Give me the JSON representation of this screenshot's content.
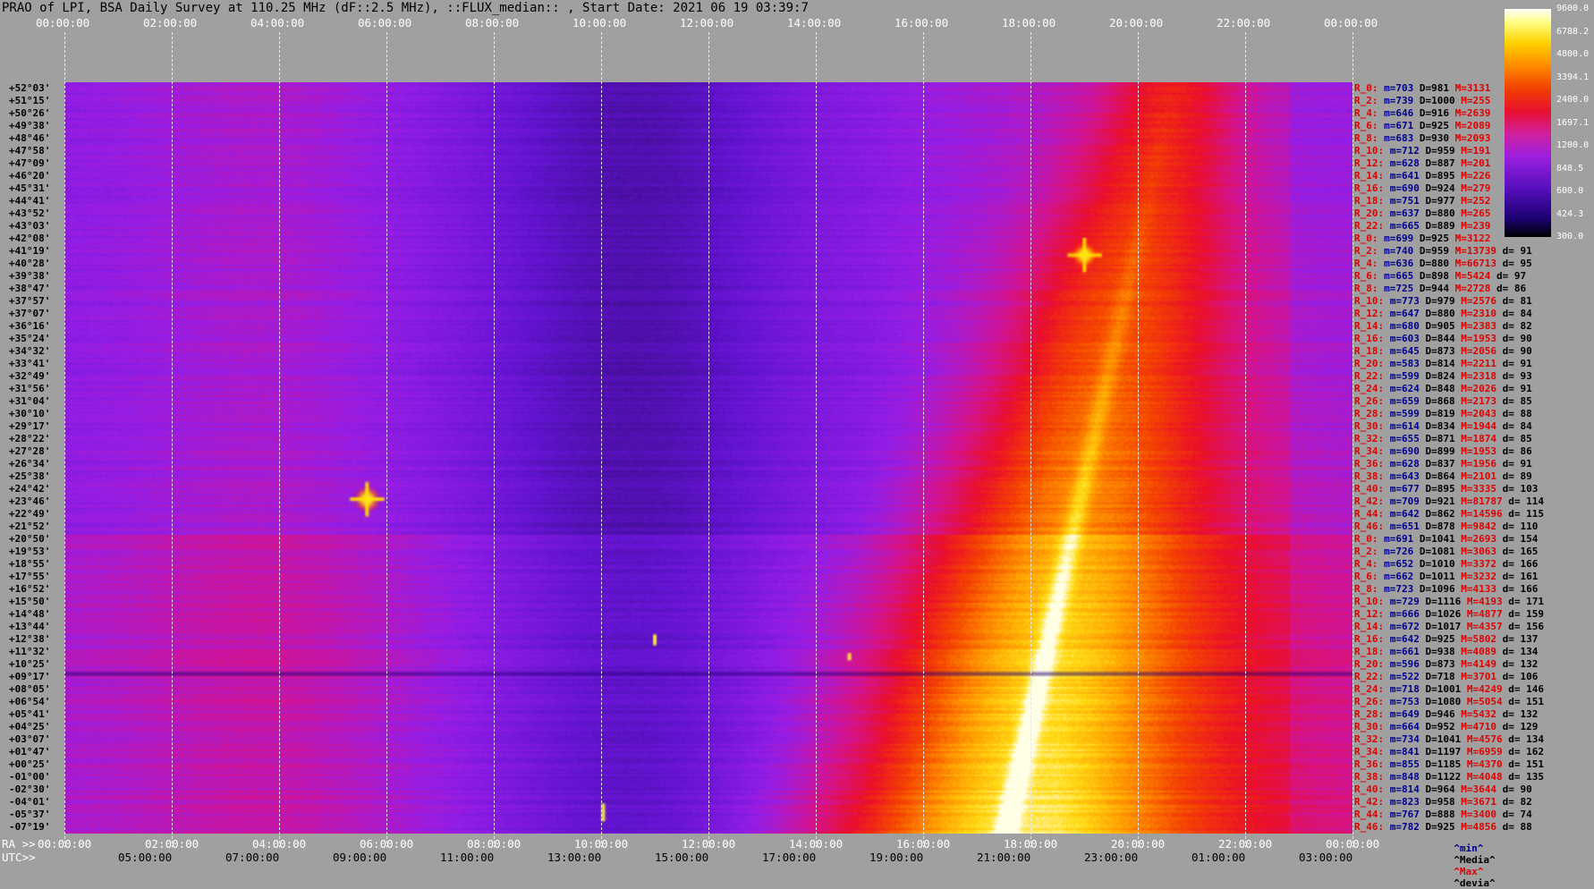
{
  "title": "PRAO of LPI, BSA Daily Survey at 110.25 MHz (dF::2.5 MHz), ::FLUX_median:: , Start Date: 2021 06 19 03:39:7",
  "top_ticks": [
    "00:00:00",
    "02:00:00",
    "04:00:00",
    "06:00:00",
    "08:00:00",
    "10:00:00",
    "12:00:00",
    "14:00:00",
    "16:00:00",
    "18:00:00",
    "20:00:00",
    "22:00:00",
    "00:00:00"
  ],
  "bottom_ra_label": "RA >>",
  "bottom_ra_ticks": [
    "00:00:00",
    "02:00:00",
    "04:00:00",
    "06:00:00",
    "08:00:00",
    "10:00:00",
    "12:00:00",
    "14:00:00",
    "16:00:00",
    "18:00:00",
    "20:00:00",
    "22:00:00",
    "00:00:00"
  ],
  "bottom_utc_label": "UTC>>",
  "bottom_utc_ticks": [
    "05:00:00",
    "07:00:00",
    "09:00:00",
    "11:00:00",
    "13:00:00",
    "15:00:00",
    "17:00:00",
    "19:00:00",
    "21:00:00",
    "23:00:00",
    "01:00:00",
    "03:00:00"
  ],
  "legend_ticks": [
    "9600.0",
    "6788.2",
    "4800.0",
    "3394.1",
    "2400.0",
    "1697.1",
    "1200.0",
    "848.5",
    "600.0",
    "424.3",
    "300.0"
  ],
  "legend_foot": {
    "min": "^min^",
    "media": "^Media^",
    "max": "^Max^",
    "devia": "^devia^"
  },
  "chart_data": {
    "type": "heatmap",
    "title": "PRAO of LPI, BSA Daily Survey at 110.25 MHz (dF::2.5 MHz), ::FLUX_median:: , Start Date: 2021 06 19 03:39:7",
    "xlabel": "RA >>",
    "x_range_hours": [
      0,
      24
    ],
    "colorbar_ticks": [
      9600.0,
      6788.2,
      4800.0,
      3394.1,
      2400.0,
      1697.1,
      1200.0,
      848.5,
      600.0,
      424.3,
      300.0
    ],
    "declinations": [
      "+52°03'",
      "+51°15'",
      "+50°26'",
      "+49°38'",
      "+48°46'",
      "+47°58'",
      "+47°09'",
      "+46°20'",
      "+45°31'",
      "+44°41'",
      "+43°52'",
      "+43°03'",
      "+42°08'",
      "+41°19'",
      "+40°28'",
      "+39°38'",
      "+38°47'",
      "+37°57'",
      "+37°07'",
      "+36°16'",
      "+35°24'",
      "+34°32'",
      "+33°41'",
      "+32°49'",
      "+31°56'",
      "+31°04'",
      "+30°10'",
      "+29°17'",
      "+28°22'",
      "+27°28'",
      "+26°34'",
      "+25°38'",
      "+24°42'",
      "+23°46'",
      "+22°49'",
      "+21°52'",
      "+20°50'",
      "+19°53'",
      "+18°55'",
      "+17°55'",
      "+16°52'",
      "+15°50'",
      "+14°48'",
      "+13°44'",
      "+12°38'",
      "+11°32'",
      "+10°25'",
      "+09°17'",
      "+08°05'",
      "+06°54'",
      "+05°41'",
      "+04°25'",
      "+03°07'",
      "+01°47'",
      "+00°25'",
      "-01°00'",
      "-02°30'",
      "-04°01'",
      "-05°37'",
      "-07°19'"
    ],
    "row_stats": [
      {
        "r": "R_0:",
        "m": "m=703",
        "d": "D=981",
        "x": "M=3131",
        "v": ""
      },
      {
        "r": "R_2:",
        "m": "m=739",
        "d": "D=1000",
        "x": "M=255",
        "v": ""
      },
      {
        "r": "R_4:",
        "m": "m=646",
        "d": "D=916",
        "x": "M=2639",
        "v": ""
      },
      {
        "r": "R_6:",
        "m": "m=671",
        "d": "D=925",
        "x": "M=2089",
        "v": ""
      },
      {
        "r": "R_8:",
        "m": "m=683",
        "d": "D=930",
        "x": "M=2093",
        "v": ""
      },
      {
        "r": "R_10:",
        "m": "m=712",
        "d": "D=959",
        "x": "M=191",
        "v": ""
      },
      {
        "r": "R_12:",
        "m": "m=628",
        "d": "D=887",
        "x": "M=201",
        "v": ""
      },
      {
        "r": "R_14:",
        "m": "m=641",
        "d": "D=895",
        "x": "M=226",
        "v": ""
      },
      {
        "r": "R_16:",
        "m": "m=690",
        "d": "D=924",
        "x": "M=279",
        "v": ""
      },
      {
        "r": "R_18:",
        "m": "m=751",
        "d": "D=977",
        "x": "M=252",
        "v": ""
      },
      {
        "r": "R_20:",
        "m": "m=637",
        "d": "D=880",
        "x": "M=265",
        "v": ""
      },
      {
        "r": "R_22:",
        "m": "m=665",
        "d": "D=889",
        "x": "M=239",
        "v": ""
      },
      {
        "r": "R_0:",
        "m": "m=699",
        "d": "D=925",
        "x": "M=3122",
        "v": ""
      },
      {
        "r": "R_2:",
        "m": "m=740",
        "d": "D=959",
        "x": "M=13739",
        "v": "d= 91"
      },
      {
        "r": "R_4:",
        "m": "m=636",
        "d": "D=880",
        "x": "M=66713",
        "v": "d= 95"
      },
      {
        "r": "R_6:",
        "m": "m=665",
        "d": "D=898",
        "x": "M=5424",
        "v": "d= 97"
      },
      {
        "r": "R_8:",
        "m": "m=725",
        "d": "D=944",
        "x": "M=2728",
        "v": "d= 86"
      },
      {
        "r": "R_10:",
        "m": "m=773",
        "d": "D=979",
        "x": "M=2576",
        "v": "d= 81"
      },
      {
        "r": "R_12:",
        "m": "m=647",
        "d": "D=880",
        "x": "M=2310",
        "v": "d= 84"
      },
      {
        "r": "R_14:",
        "m": "m=680",
        "d": "D=905",
        "x": "M=2383",
        "v": "d= 82"
      },
      {
        "r": "R_16:",
        "m": "m=603",
        "d": "D=844",
        "x": "M=1953",
        "v": "d= 90"
      },
      {
        "r": "R_18:",
        "m": "m=645",
        "d": "D=873",
        "x": "M=2056",
        "v": "d= 90"
      },
      {
        "r": "R_20:",
        "m": "m=583",
        "d": "D=814",
        "x": "M=2211",
        "v": "d= 91"
      },
      {
        "r": "R_22:",
        "m": "m=599",
        "d": "D=824",
        "x": "M=2318",
        "v": "d= 93"
      },
      {
        "r": "R_24:",
        "m": "m=624",
        "d": "D=848",
        "x": "M=2026",
        "v": "d= 91"
      },
      {
        "r": "R_26:",
        "m": "m=659",
        "d": "D=868",
        "x": "M=2173",
        "v": "d= 85"
      },
      {
        "r": "R_28:",
        "m": "m=599",
        "d": "D=819",
        "x": "M=2043",
        "v": "d= 88"
      },
      {
        "r": "R_30:",
        "m": "m=614",
        "d": "D=834",
        "x": "M=1944",
        "v": "d= 84"
      },
      {
        "r": "R_32:",
        "m": "m=655",
        "d": "D=871",
        "x": "M=1874",
        "v": "d= 85"
      },
      {
        "r": "R_34:",
        "m": "m=690",
        "d": "D=899",
        "x": "M=1953",
        "v": "d= 86"
      },
      {
        "r": "R_36:",
        "m": "m=628",
        "d": "D=837",
        "x": "M=1956",
        "v": "d= 91"
      },
      {
        "r": "R_38:",
        "m": "m=643",
        "d": "D=864",
        "x": "M=2101",
        "v": "d= 89"
      },
      {
        "r": "R_40:",
        "m": "m=677",
        "d": "D=895",
        "x": "M=3335",
        "v": "d= 103"
      },
      {
        "r": "R_42:",
        "m": "m=709",
        "d": "D=921",
        "x": "M=81787",
        "v": "d= 114"
      },
      {
        "r": "R_44:",
        "m": "m=642",
        "d": "D=862",
        "x": "M=14596",
        "v": "d= 115"
      },
      {
        "r": "R_46:",
        "m": "m=651",
        "d": "D=878",
        "x": "M=9842",
        "v": "d= 110"
      },
      {
        "r": "R_0:",
        "m": "m=691",
        "d": "D=1041",
        "x": "M=2693",
        "v": "d= 154"
      },
      {
        "r": "R_2:",
        "m": "m=726",
        "d": "D=1081",
        "x": "M=3063",
        "v": "d= 165"
      },
      {
        "r": "R_4:",
        "m": "m=652",
        "d": "D=1010",
        "x": "M=3372",
        "v": "d= 166"
      },
      {
        "r": "R_6:",
        "m": "m=662",
        "d": "D=1011",
        "x": "M=3232",
        "v": "d= 161"
      },
      {
        "r": "R_8:",
        "m": "m=723",
        "d": "D=1096",
        "x": "M=4133",
        "v": "d= 166"
      },
      {
        "r": "R_10:",
        "m": "m=729",
        "d": "D=1116",
        "x": "M=4193",
        "v": "d= 171"
      },
      {
        "r": "R_12:",
        "m": "m=666",
        "d": "D=1026",
        "x": "M=4877",
        "v": "d= 159"
      },
      {
        "r": "R_14:",
        "m": "m=672",
        "d": "D=1017",
        "x": "M=4357",
        "v": "d= 156"
      },
      {
        "r": "R_16:",
        "m": "m=642",
        "d": "D=925",
        "x": "M=5802",
        "v": "d= 137"
      },
      {
        "r": "R_18:",
        "m": "m=661",
        "d": "D=938",
        "x": "M=4089",
        "v": "d= 134"
      },
      {
        "r": "R_20:",
        "m": "m=596",
        "d": "D=873",
        "x": "M=4149",
        "v": "d= 132"
      },
      {
        "r": "R_22:",
        "m": "m=522",
        "d": "D=718",
        "x": "M=3701",
        "v": "d= 106"
      },
      {
        "r": "R_24:",
        "m": "m=718",
        "d": "D=1001",
        "x": "M=4249",
        "v": "d= 146"
      },
      {
        "r": "R_26:",
        "m": "m=753",
        "d": "D=1080",
        "x": "M=5054",
        "v": "d= 151"
      },
      {
        "r": "R_28:",
        "m": "m=649",
        "d": "D=946",
        "x": "M=5432",
        "v": "d= 132"
      },
      {
        "r": "R_30:",
        "m": "m=664",
        "d": "D=952",
        "x": "M=4710",
        "v": "d= 129"
      },
      {
        "r": "R_32:",
        "m": "m=734",
        "d": "D=1041",
        "x": "M=4576",
        "v": "d= 134"
      },
      {
        "r": "R_34:",
        "m": "m=841",
        "d": "D=1197",
        "x": "M=6959",
        "v": "d= 162"
      },
      {
        "r": "R_36:",
        "m": "m=855",
        "d": "D=1185",
        "x": "M=4370",
        "v": "d= 151"
      },
      {
        "r": "R_38:",
        "m": "m=848",
        "d": "D=1122",
        "x": "M=4048",
        "v": "d= 135"
      },
      {
        "r": "R_40:",
        "m": "m=814",
        "d": "D=964",
        "x": "M=3644",
        "v": "d= 90"
      },
      {
        "r": "R_42:",
        "m": "m=823",
        "d": "D=958",
        "x": "M=3671",
        "v": "d= 82"
      },
      {
        "r": "R_44:",
        "m": "m=767",
        "d": "D=888",
        "x": "M=3400",
        "v": "d= 74"
      },
      {
        "r": "R_46:",
        "m": "m=782",
        "d": "D=925",
        "x": "M=4856",
        "v": "d= 88"
      }
    ]
  }
}
